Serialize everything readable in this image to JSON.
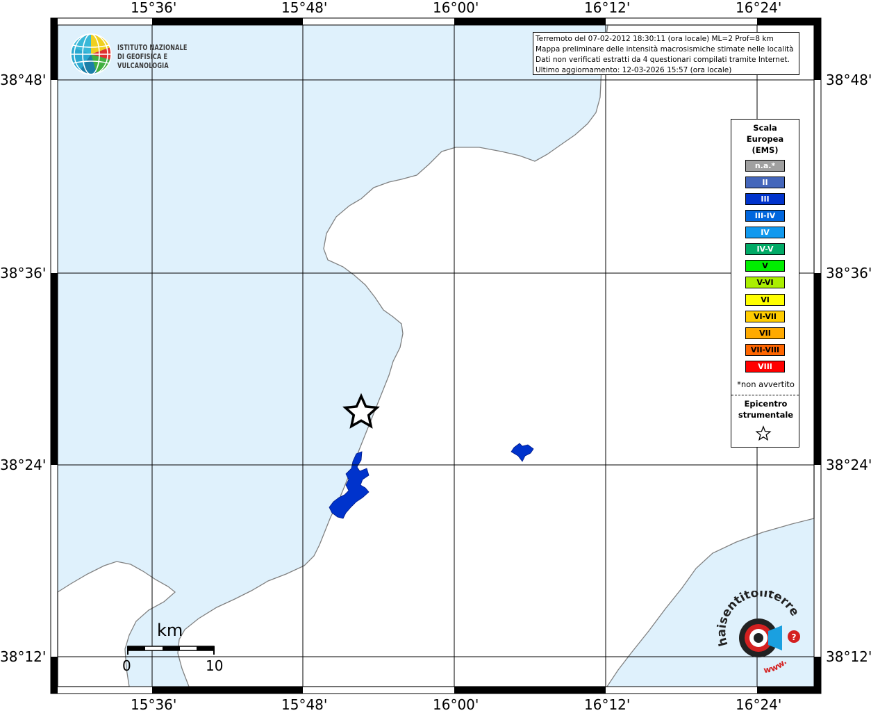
{
  "map": {
    "lon_ticks": [
      "15°36'",
      "15°48'",
      "16°00'",
      "16°12'",
      "16°24'"
    ],
    "lat_ticks": [
      "38°48'",
      "38°36'",
      "38°24'",
      "38°12'"
    ],
    "colors": {
      "sea": "#dff1fc",
      "land": "#ffffff",
      "coastline": "#808080",
      "grid": "#000000",
      "felt_area": "#0033cc"
    }
  },
  "info": {
    "lines": [
      "Terremoto del 07-02-2012 18:30:11 (ora locale) ML=2 Prof=8 km",
      "Mappa preliminare delle intensità macrosismiche stimate nelle località",
      "Dati non verificati estratti da 4 questionari compilati tramite Internet.",
      "Ultimo aggiornamento: 12-03-2026 15:57 (ora locale)"
    ]
  },
  "logo": {
    "line1": "ISTITUTO NAZIONALE",
    "line2": "DI GEOFISICA E VULCANOLOGIA"
  },
  "legend": {
    "title_lines": [
      "Scala",
      "Europea",
      "(EMS)"
    ],
    "items": [
      {
        "label": "n.a.*",
        "color": "#a0a0a0"
      },
      {
        "label": "II",
        "color": "#4466bb"
      },
      {
        "label": "III",
        "color": "#0033cc"
      },
      {
        "label": "III-IV",
        "color": "#0066dd"
      },
      {
        "label": "IV",
        "color": "#1199ee"
      },
      {
        "label": "IV-V",
        "color": "#00aa66"
      },
      {
        "label": "V",
        "color": "#00ee00"
      },
      {
        "label": "V-VI",
        "color": "#aaee00"
      },
      {
        "label": "VI",
        "color": "#ffff00"
      },
      {
        "label": "VI-VII",
        "color": "#ffcc00"
      },
      {
        "label": "VII",
        "color": "#ffaa00"
      },
      {
        "label": "VII-VIII",
        "color": "#ff6600"
      },
      {
        "label": "VIII",
        "color": "#ff0000"
      }
    ],
    "note": "*non avvertito",
    "epicenter_lines": [
      "Epicentro",
      "strumentale"
    ]
  },
  "scale_bar": {
    "unit": "km",
    "start": "0",
    "end": "10"
  },
  "hst_logo": {
    "text_main": "haisentitoilterremoto.it",
    "text_www": "www."
  }
}
